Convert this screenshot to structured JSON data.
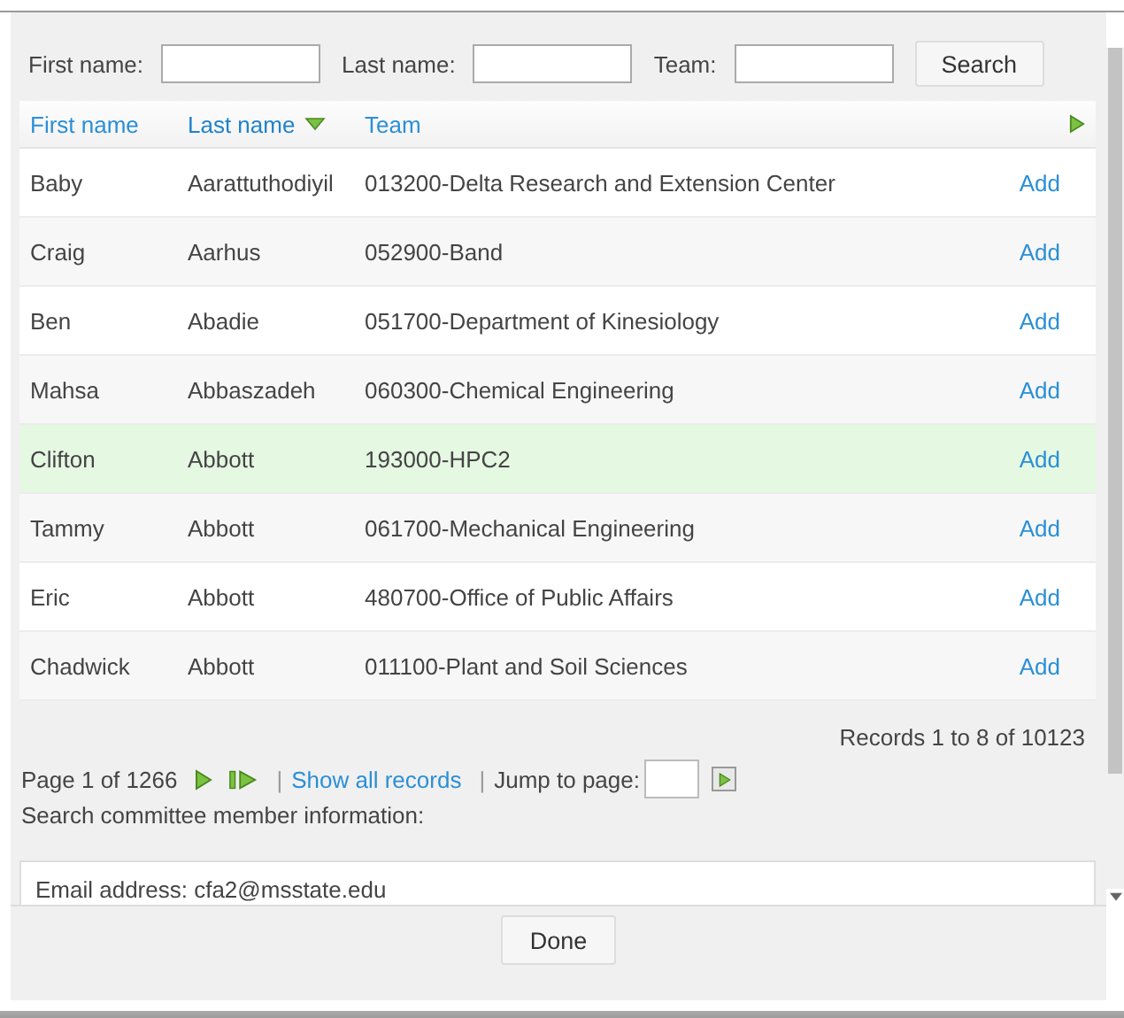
{
  "search_form": {
    "fields": [
      {
        "label": "First name:"
      },
      {
        "label": "Last name:"
      },
      {
        "label": "Team:"
      }
    ],
    "button": "Search"
  },
  "table": {
    "columns": [
      {
        "label": "First name",
        "sorted": false
      },
      {
        "label": "Last name",
        "sorted": true
      },
      {
        "label": "Team",
        "sorted": false
      }
    ],
    "rows": [
      {
        "first_name": "Baby",
        "last_name": "Aarattuthodiyil",
        "team": "013200-Delta Research and Extension Center",
        "action": "Add",
        "selected": false
      },
      {
        "first_name": "Craig",
        "last_name": "Aarhus",
        "team": "052900-Band",
        "action": "Add",
        "selected": false
      },
      {
        "first_name": "Ben",
        "last_name": "Abadie",
        "team": "051700-Department of Kinesiology",
        "action": "Add",
        "selected": false
      },
      {
        "first_name": "Mahsa",
        "last_name": "Abbaszadeh",
        "team": "060300-Chemical Engineering",
        "action": "Add",
        "selected": false
      },
      {
        "first_name": "Clifton",
        "last_name": "Abbott",
        "team": "193000-HPC2",
        "action": "Add",
        "selected": true
      },
      {
        "first_name": "Tammy",
        "last_name": "Abbott",
        "team": "061700-Mechanical Engineering",
        "action": "Add",
        "selected": false
      },
      {
        "first_name": "Eric",
        "last_name": "Abbott",
        "team": "480700-Office of Public Affairs",
        "action": "Add",
        "selected": false
      },
      {
        "first_name": "Chadwick",
        "last_name": "Abbott",
        "team": "011100-Plant and Soil Sciences",
        "action": "Add",
        "selected": false
      }
    ]
  },
  "records": "Records 1 to 8 of 10123",
  "pager": {
    "page": "Page 1 of 1266",
    "separator_1": "|",
    "show_all": "Show all records",
    "separator_2": "|",
    "jump_label": "Jump to page:"
  },
  "info_label": "Search committee member information:",
  "info_text": "Email address: cfa2@msstate.edu",
  "done_button": "Done"
}
